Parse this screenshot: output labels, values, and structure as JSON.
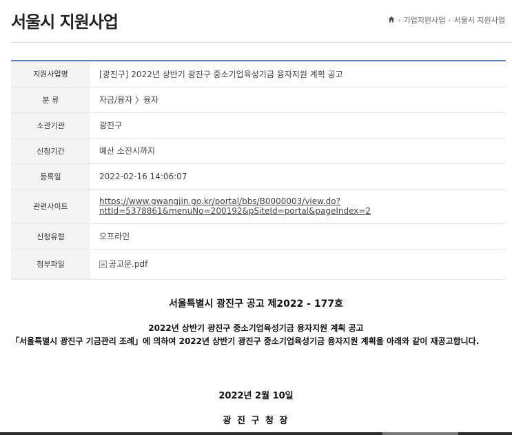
{
  "header": {
    "title": "서울시 지원사업",
    "breadcrumb": [
      "기업지원사업",
      "서울시 지원사업"
    ]
  },
  "info_rows": [
    {
      "label": "지원사업명",
      "value": "[광진구] 2022년 상반기 광진구 중소기업육성기금 융자지원 계획 공고"
    },
    {
      "label": "분 류",
      "value": "자금/융자 〉융자"
    },
    {
      "label": "소관기관",
      "value": "광진구"
    },
    {
      "label": "신청기간",
      "value": "예산 소진시까지"
    },
    {
      "label": "등록일",
      "value": "2022-02-16 14:06:07"
    },
    {
      "label": "관련사이트",
      "value": "https://www.gwangjin.go.kr/portal/bbs/B0000003/view.do?nttId=5378861&menuNo=200192&pSiteId=portal&pageIndex=2",
      "value_line1": "https://www.gwangjin.go.kr/portal/bbs/B0000003/view.do?",
      "value_line2": "nttId=5378861&menuNo=200192&pSiteId=portal&pageIndex=2"
    },
    {
      "label": "신청유형",
      "value": "오프라인"
    },
    {
      "label": "첨부파일",
      "value": "공고문.pdf"
    }
  ],
  "document": {
    "title": "서울특별시 광진구 공고 제2022 - 177호",
    "subtitle": "2022년 상반기 광진구 중소기업육성기금 융자지원 계획 공고",
    "body": "「서울특별시 광진구 기금관리 조례」에 의하여 2022년 상반기 광진구 중소기업육성기금 융자지원 계획을 아래와 같이 재공고합니다.",
    "date": "2022년 2월 10일",
    "signature": "광 진 구 청 장"
  },
  "colors": {
    "table_top_border": "#5b7dbd",
    "label_bg": "#f4f4f4"
  },
  "icons": [
    "home-icon",
    "file-icon"
  ]
}
